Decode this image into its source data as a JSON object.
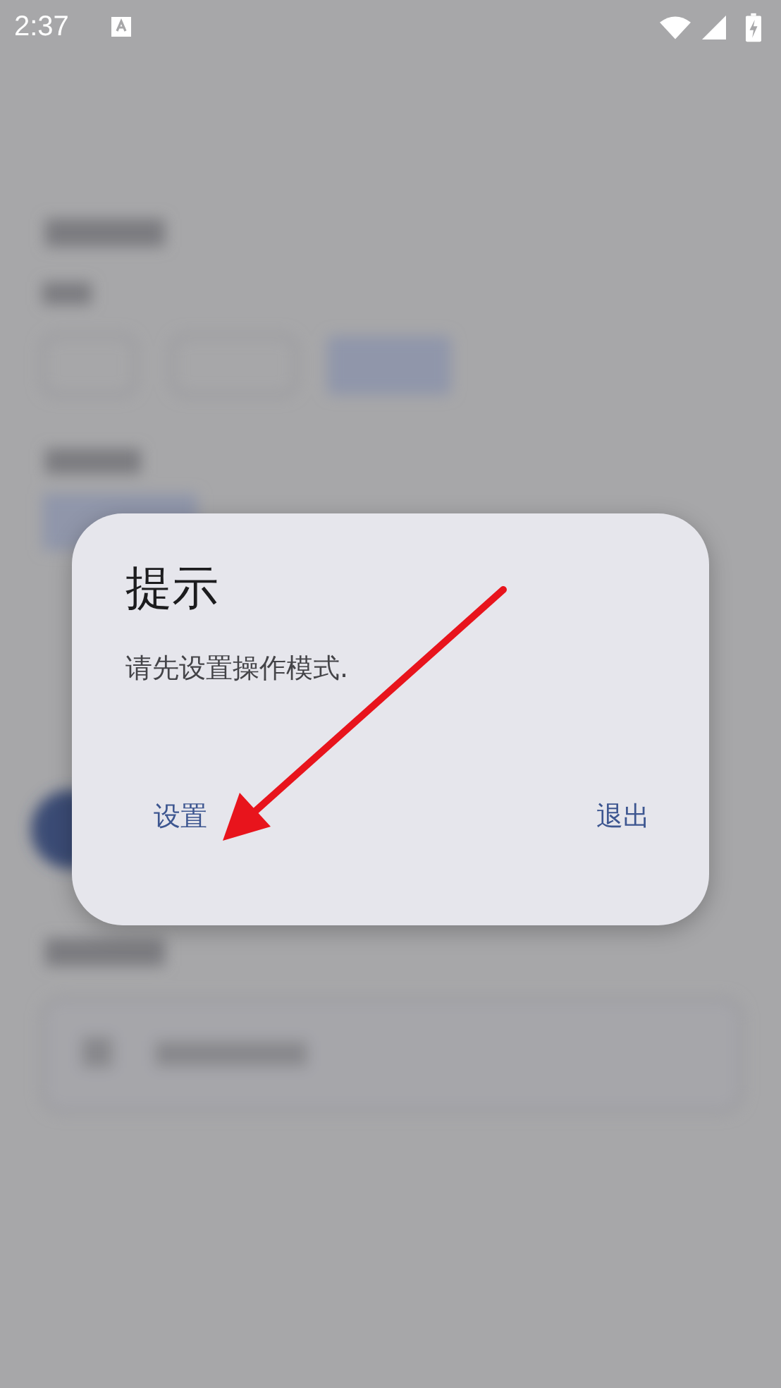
{
  "status_bar": {
    "time": "2:37"
  },
  "dialog": {
    "title": "提示",
    "message": "请先设置操作模式.",
    "buttons": [
      {
        "label": "设置"
      },
      {
        "label": "退出"
      }
    ]
  }
}
